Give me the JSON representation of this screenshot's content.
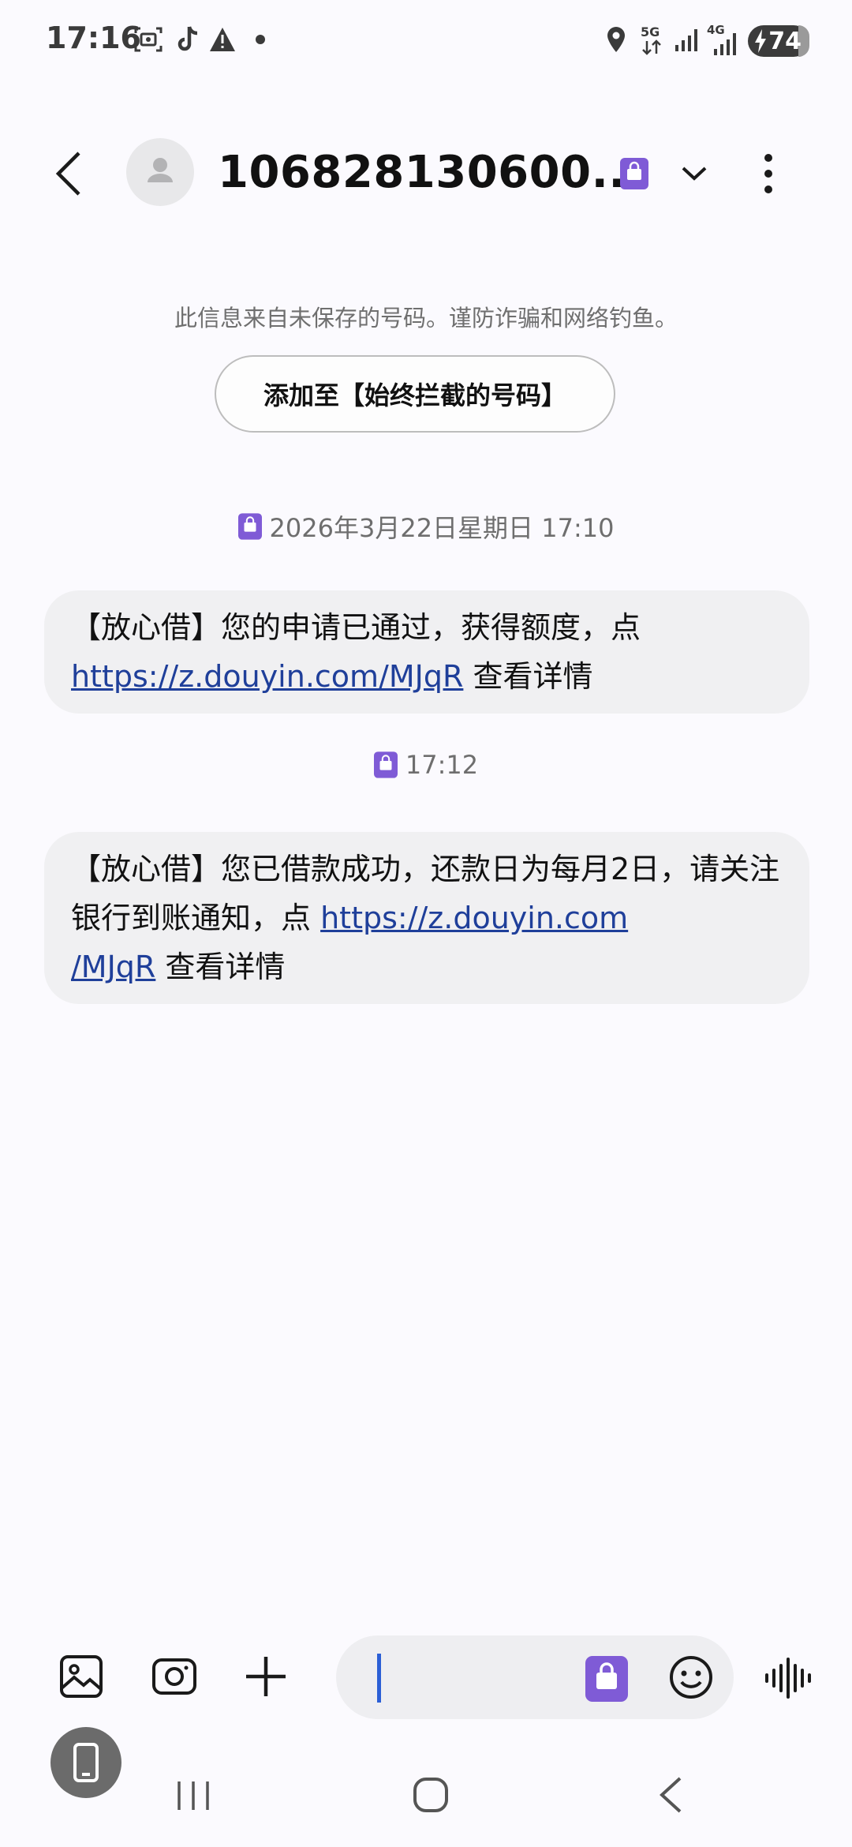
{
  "status_bar": {
    "time": "17:16",
    "icons": [
      "screenshot-icon",
      "tiktok-icon",
      "warning-icon",
      "dot-icon",
      "location-icon",
      "5g-data-icon",
      "signal-icon",
      "4g-signal-icon"
    ],
    "network_5g": "5G",
    "network_4g": "4G",
    "battery": "74"
  },
  "header": {
    "title": "106828130600...",
    "icons": [
      "back-arrow-icon",
      "contact-avatar-icon",
      "sim-card-icon",
      "chevron-down-icon",
      "more-vert-icon"
    ]
  },
  "notice": {
    "warning_text": "此信息来自未保存的号码。谨防诈骗和网络钓鱼。",
    "block_button_label": "添加至【始终拦截的号码】"
  },
  "messages": [
    {
      "timestamp": "2026年3月22日星期日 17:10",
      "text_before": "【放心借】您的申请已通过，获得额度，点",
      "link_text": "https://z.douyin.com/MJqR",
      "text_after": " 查看详情"
    },
    {
      "timestamp": "17:12",
      "text_before": "【放心借】您已借款成功，还款日为每月2日，请关注银行到账通知，点 ",
      "link_text_line1": "https://z.douyin.com",
      "link_text_line2": "/MJqR",
      "text_after": " 查看详情"
    }
  ],
  "composer": {
    "icons": [
      "gallery-icon",
      "camera-icon",
      "plus-icon",
      "sim-card-icon",
      "emoji-icon",
      "voice-wave-icon"
    ]
  },
  "bottom": {
    "icons": [
      "floating-phone-icon",
      "nav-recent-icon",
      "nav-home-icon",
      "nav-back-icon"
    ]
  },
  "colors": {
    "accent_purple": "#7f5bd6",
    "link_blue": "#1f3f9a",
    "bubble_bg": "#f0f0f2",
    "page_bg": "#fbfafe"
  }
}
